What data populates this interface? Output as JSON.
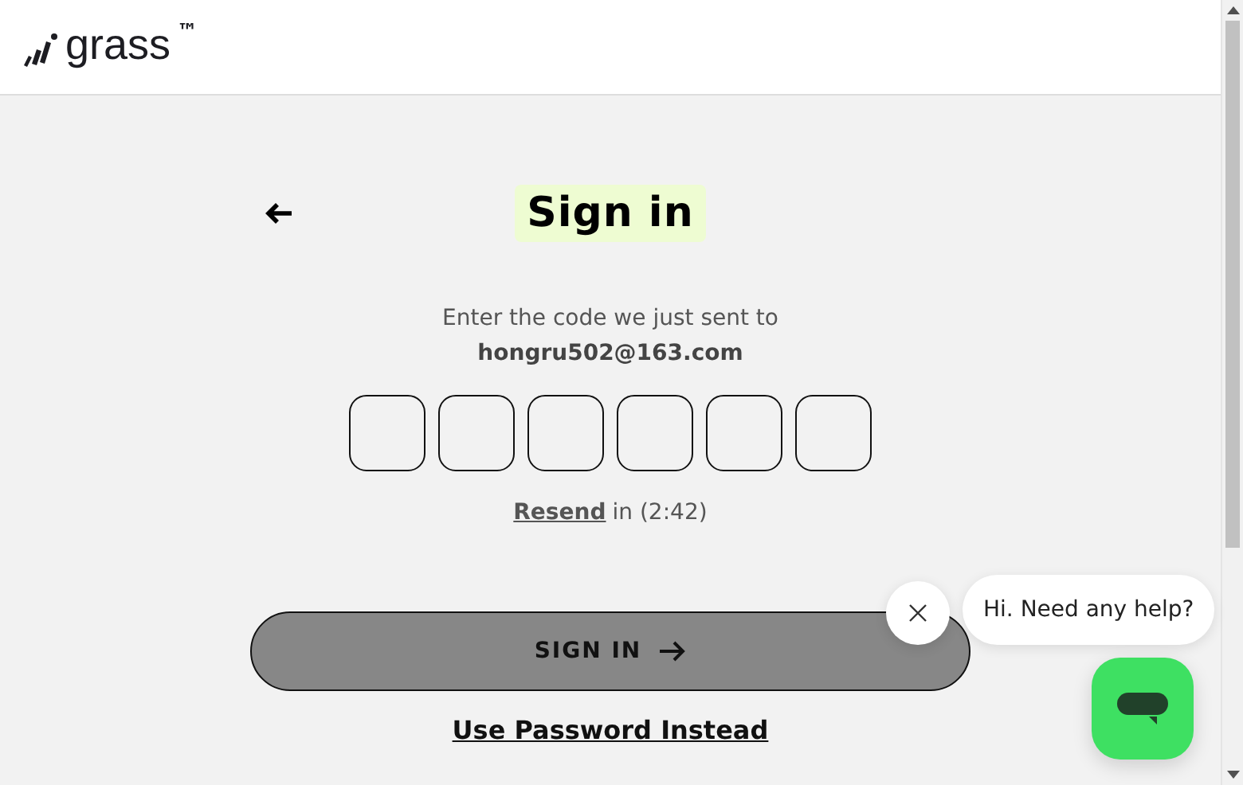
{
  "header": {
    "logo": {
      "name": "grass",
      "mark": "™"
    }
  },
  "form": {
    "title": "Sign in",
    "prompt": "Enter the code we just sent to",
    "email": "hongru502@163.com",
    "code_fields": [
      {
        "kind": "digit"
      },
      {
        "kind": "digit"
      },
      {
        "kind": "digit"
      },
      {
        "kind": "digit"
      },
      {
        "kind": "digit"
      },
      {
        "kind": "digit"
      }
    ],
    "resend": {
      "link": "Resend",
      "countdown": "in (2:42)"
    },
    "submit": "SIGN IN",
    "alternate_link": "Use Password Instead"
  },
  "chat": {
    "greeting": "Hi. Need any help?"
  }
}
